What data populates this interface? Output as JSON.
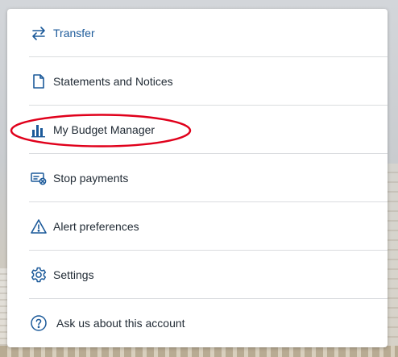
{
  "menu": {
    "items": [
      {
        "key": "transfer",
        "label": "Transfer",
        "icon": "transfer-arrows-icon",
        "active": true
      },
      {
        "key": "statements",
        "label": "Statements and Notices",
        "icon": "document-icon"
      },
      {
        "key": "budget",
        "label": "My Budget Manager",
        "icon": "bar-chart-icon",
        "highlighted": true
      },
      {
        "key": "stop-payments",
        "label": "Stop payments",
        "icon": "stop-payment-check-icon"
      },
      {
        "key": "alerts",
        "label": "Alert preferences",
        "icon": "warning-triangle-icon"
      },
      {
        "key": "settings",
        "label": "Settings",
        "icon": "gear-icon"
      },
      {
        "key": "help",
        "label": "Ask us about this account",
        "icon": "question-circle-icon"
      }
    ]
  },
  "colors": {
    "accent": "#1c5a9a",
    "text": "#1f2933",
    "divider": "#dadcdf",
    "annotation": "#e0001b"
  }
}
